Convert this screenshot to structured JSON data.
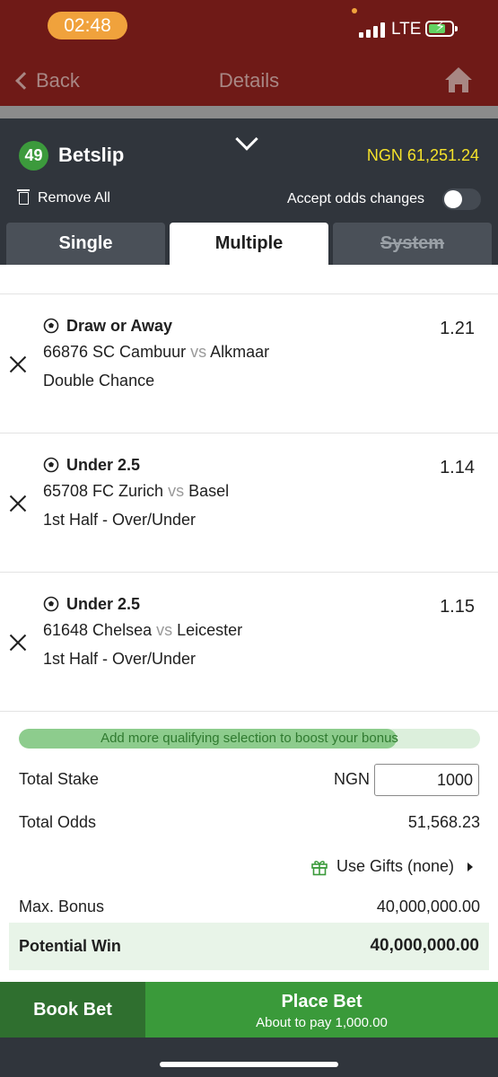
{
  "status_bar": {
    "time": "02:48",
    "network": "LTE"
  },
  "nav": {
    "back_label": "Back",
    "title": "Details",
    "home_icon": "home-icon"
  },
  "betslip": {
    "count": "49",
    "title": "Betslip",
    "balance": "NGN 61,251.24",
    "remove_all": "Remove All",
    "accept_odds_label": "Accept odds changes",
    "accept_odds_on": false
  },
  "tabs": [
    {
      "label": "Single"
    },
    {
      "label": "Multiple",
      "active": true
    },
    {
      "label": "System",
      "disabled": true
    }
  ],
  "selections": [
    {
      "pick": "Draw or Away",
      "odds": "1.21",
      "match_prefix": "66876 SC Cambuur",
      "vs": "vs",
      "away": "Alkmaar",
      "market": "Double Chance"
    },
    {
      "pick": "Under 2.5",
      "odds": "1.14",
      "match_prefix": "65708 FC Zurich",
      "vs": "vs",
      "away": "Basel",
      "market": "1st Half - Over/Under"
    },
    {
      "pick": "Under 2.5",
      "odds": "1.15",
      "match_prefix": "61648 Chelsea",
      "vs": "vs",
      "away": "Leicester",
      "market": "1st Half - Over/Under"
    }
  ],
  "bonus_progress": {
    "text": "Add more qualifying selection to boost your bonus",
    "progress": 0.82
  },
  "summary": {
    "total_stake_label": "Total Stake",
    "currency": "NGN",
    "stake_value": "1000",
    "total_odds_label": "Total Odds",
    "total_odds": "51,568.23",
    "use_gifts": "Use Gifts (none)",
    "max_bonus_label": "Max. Bonus",
    "max_bonus": "40,000,000.00",
    "potential_win_label": "Potential Win",
    "potential_win": "40,000,000.00"
  },
  "actions": {
    "book_bet": "Book Bet",
    "place_bet": "Place Bet",
    "about_to_pay": "About to pay 1,000.00"
  },
  "colors": {
    "topbar": "#6f1a17",
    "betslip_header": "#30353c",
    "accent_green": "#3a9a3a",
    "balance_yellow": "#f5e22a"
  }
}
